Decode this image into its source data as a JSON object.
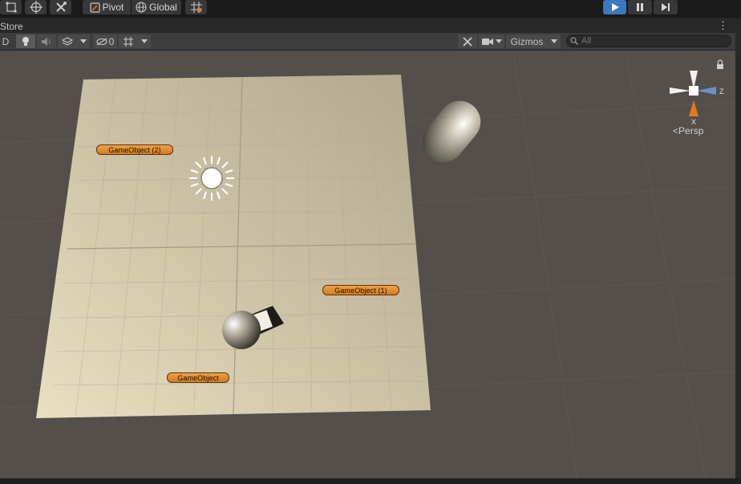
{
  "toolbar": {
    "pivot_label": "Pivot",
    "global_label": "Global",
    "tools": [
      "rect-tool-icon",
      "transform-tool-icon",
      "custom-tool-icon"
    ],
    "play_controls": [
      "play-icon",
      "pause-icon",
      "step-icon"
    ],
    "play_active_color": "#3a79bb"
  },
  "tab": {
    "title": "Store",
    "menu": "⋮"
  },
  "scene_toolbar": {
    "mode_partial": "D",
    "hidden_count": "0",
    "gizmos_label": "Gizmos",
    "search_placeholder": "All"
  },
  "scene": {
    "objects": [
      "GameObject (2)",
      "GameObject (1)",
      "GameObject"
    ],
    "orientation": {
      "axis_x": "X",
      "axis_z": "Z",
      "projection": "Persp"
    },
    "colors": {
      "background": "#544f4a",
      "plane": "#cfc4a6",
      "label": "#e08a2b"
    }
  }
}
